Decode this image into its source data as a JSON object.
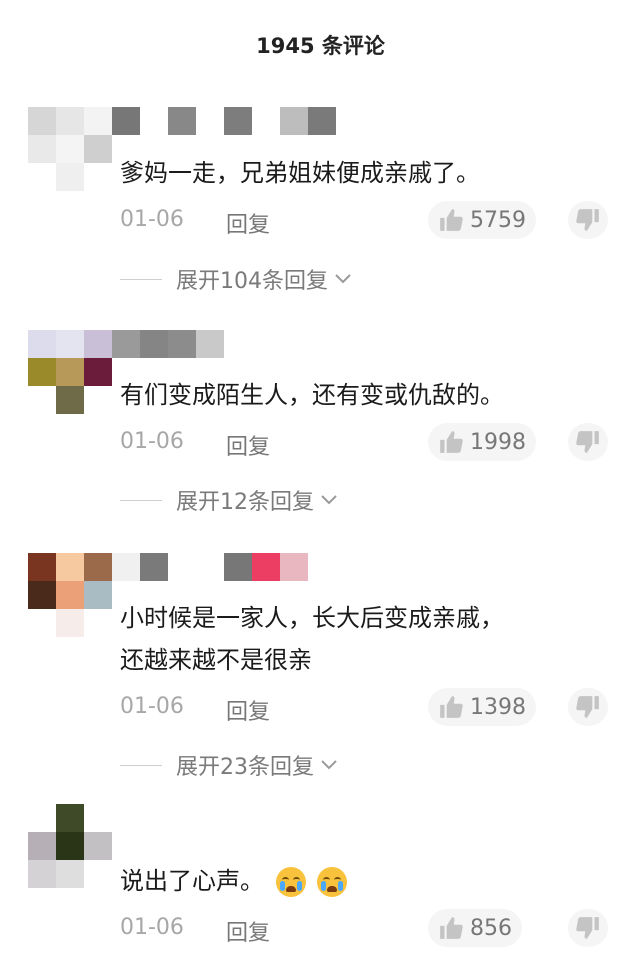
{
  "header": {
    "title": "1945 条评论"
  },
  "colors": {
    "date": "#a7a7a7",
    "reply": "#777777",
    "pill_bg": "#f5f5f5",
    "icon": "#c4c4c4"
  },
  "icons": {
    "like": "thumb-up-icon",
    "dislike": "thumb-down-icon",
    "expand": "chevron-down-icon"
  },
  "comments": [
    {
      "text": "爹妈一走，兄弟姐妹便成亲戚了。",
      "date": "01-06",
      "reply_label": "回复",
      "likes": "5759",
      "expand_label": "展开104条回复"
    },
    {
      "text": "有们变成陌生人，还有变或仇敌的。",
      "date": "01-06",
      "reply_label": "回复",
      "likes": "1998",
      "expand_label": "展开12条回复"
    },
    {
      "text_line1": "小时候是一家人，长大后变成亲戚，",
      "text_line2": "还越来越不是很亲",
      "date": "01-06",
      "reply_label": "回复",
      "likes": "1398",
      "expand_label": "展开23条回复"
    },
    {
      "text": "说出了心声。",
      "date": "01-06",
      "reply_label": "回复",
      "likes": "856"
    }
  ]
}
